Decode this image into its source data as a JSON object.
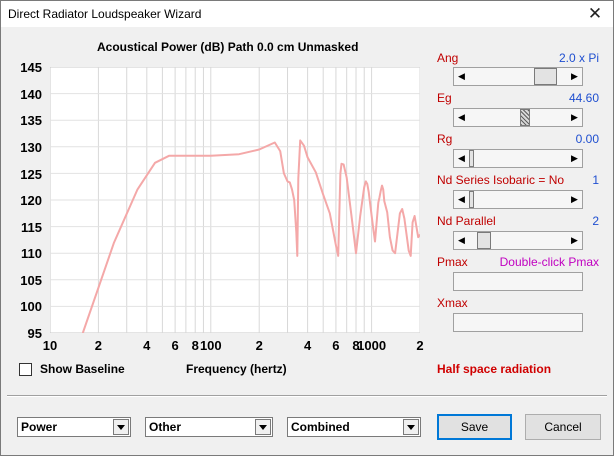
{
  "window": {
    "title": "Direct Radiator Loudspeaker Wizard",
    "close_glyph": "✕"
  },
  "plot": {
    "title": "Acoustical Power (dB)   Path 0.0 cm   Unmasked",
    "xlabel": "Frequency (hertz)",
    "y_ticks": [
      "145",
      "140",
      "135",
      "130",
      "125",
      "120",
      "115",
      "110",
      "105",
      "100",
      "95"
    ],
    "x_ticks": [
      "10",
      "2",
      "4",
      "6",
      "8",
      "100",
      "2",
      "4",
      "6",
      "8",
      "1000",
      "2"
    ]
  },
  "chart_data": {
    "type": "line",
    "title": "Acoustical Power (dB)   Path 0.0 cm   Unmasked",
    "xlabel": "Frequency (hertz)",
    "ylabel": "",
    "x_scale": "log",
    "xlim": [
      10,
      2000
    ],
    "ylim": [
      95,
      145
    ],
    "grid": true,
    "line_color": "#f4a8a8",
    "x": [
      16,
      25,
      35,
      45,
      55,
      70,
      100,
      150,
      200,
      250,
      270,
      285,
      300,
      310,
      320,
      330,
      340,
      345,
      350,
      360,
      380,
      400,
      450,
      500,
      550,
      600,
      620,
      640,
      650,
      670,
      700,
      750,
      800,
      850,
      900,
      920,
      940,
      960,
      980,
      1020,
      1050,
      1100,
      1120,
      1140,
      1160,
      1180,
      1200,
      1250,
      1300,
      1350,
      1400,
      1500,
      1550,
      1600,
      1700,
      1750,
      1800,
      1850,
      1900,
      1950,
      2000
    ],
    "y": [
      95,
      112,
      122,
      127,
      128.3,
      128.3,
      128.3,
      128.6,
      129.5,
      130.8,
      129.2,
      125,
      123.5,
      123.3,
      122,
      120,
      114,
      109.5,
      124,
      131.2,
      130.2,
      128,
      125.2,
      121,
      117.5,
      111.5,
      109.5,
      125,
      126.8,
      126.7,
      124.2,
      117,
      110,
      117,
      122.4,
      123.5,
      123,
      121.5,
      119.2,
      115,
      112.2,
      119.5,
      120.5,
      121.7,
      122.7,
      122,
      119.8,
      117.7,
      113,
      110.5,
      110,
      117.5,
      118.3,
      116.5,
      110.5,
      109.5,
      115.8,
      117,
      115,
      113,
      113.5
    ]
  },
  "baseline": {
    "label": "Show Baseline",
    "checked": false
  },
  "params": {
    "ang": {
      "label": "Ang",
      "value": "2.0 x Pi"
    },
    "eg": {
      "label": "Eg",
      "value": "44.60"
    },
    "rg": {
      "label": "Rg",
      "value": "0.00"
    },
    "nd_series": {
      "label": "Nd Series",
      "extra": "Isobaric = No",
      "value": "1"
    },
    "nd_parallel": {
      "label": "Nd  Parallel",
      "value": "2"
    },
    "pmax": {
      "label": "Pmax",
      "value": "Double-click Pmax"
    },
    "xmax": {
      "label": "Xmax",
      "value": ""
    }
  },
  "slider_levels": {
    "ang": 0.87,
    "eg": 0.58,
    "rg": 0.0,
    "nd_series": 0.0,
    "nd_parallel": 0.1
  },
  "status": {
    "radiation": "Half space radiation",
    "color": "#d00000"
  },
  "bottom": {
    "combo1": "Power",
    "combo2": "Other",
    "combo3": "Combined",
    "save": "Save",
    "cancel": "Cancel"
  },
  "arrows": {
    "left": "◀",
    "right": "▶"
  }
}
